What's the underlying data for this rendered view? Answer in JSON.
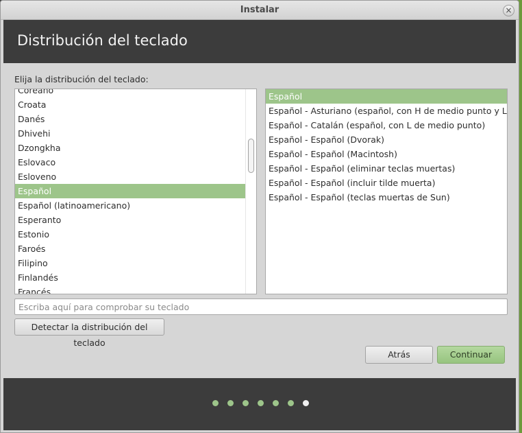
{
  "window": {
    "title": "Instalar",
    "close_glyph": "×"
  },
  "header": {
    "title": "Distribución del teclado"
  },
  "prompt_label": "Elija la distribución del teclado:",
  "layouts": {
    "items": [
      {
        "label": "Coreano",
        "selected": false
      },
      {
        "label": "Croata",
        "selected": false
      },
      {
        "label": "Danés",
        "selected": false
      },
      {
        "label": "Dhivehi",
        "selected": false
      },
      {
        "label": "Dzongkha",
        "selected": false
      },
      {
        "label": "Eslovaco",
        "selected": false
      },
      {
        "label": "Esloveno",
        "selected": false
      },
      {
        "label": "Español",
        "selected": true
      },
      {
        "label": "Español (latinoamericano)",
        "selected": false
      },
      {
        "label": "Esperanto",
        "selected": false
      },
      {
        "label": "Estonio",
        "selected": false
      },
      {
        "label": "Faroés",
        "selected": false
      },
      {
        "label": "Filipino",
        "selected": false
      },
      {
        "label": "Finlandés",
        "selected": false
      },
      {
        "label": "Francés",
        "selected": false
      }
    ]
  },
  "variants": {
    "items": [
      {
        "label": "Español",
        "selected": true
      },
      {
        "label": "Español - Asturiano (español, con H de medio punto y L de medio punto)",
        "selected": false
      },
      {
        "label": "Español - Catalán (español, con L de medio punto)",
        "selected": false
      },
      {
        "label": "Español - Español (Dvorak)",
        "selected": false
      },
      {
        "label": "Español - Español (Macintosh)",
        "selected": false
      },
      {
        "label": "Español - Español (eliminar teclas muertas)",
        "selected": false
      },
      {
        "label": "Español - Español (incluir tilde muerta)",
        "selected": false
      },
      {
        "label": "Español - Español (teclas muertas de Sun)",
        "selected": false
      }
    ]
  },
  "test_input": {
    "value": "",
    "placeholder": "Escriba aquí para comprobar su teclado"
  },
  "buttons": {
    "detect": "Detectar la distribución del teclado",
    "back": "Atrás",
    "continue": "Continuar"
  },
  "progress": {
    "total_steps": 7,
    "current_step": 7
  },
  "colors": {
    "accent": "#9dc58a",
    "band": "#3c3c3c",
    "window_bg": "#d6d6d6"
  }
}
